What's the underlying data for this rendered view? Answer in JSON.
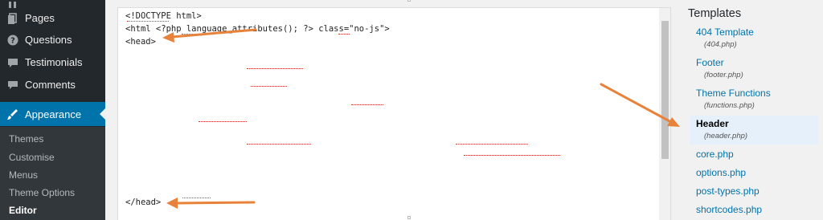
{
  "sidebar": {
    "items": [
      {
        "label": "Pages",
        "icon": "pages-icon"
      },
      {
        "label": "Questions",
        "icon": "question-icon"
      },
      {
        "label": "Testimonials",
        "icon": "testimonials-icon"
      },
      {
        "label": "Comments",
        "icon": "comments-icon"
      },
      {
        "label": "Appearance",
        "icon": "brush-icon"
      }
    ],
    "submenu": [
      "Themes",
      "Customise",
      "Menus",
      "Theme Options",
      "Editor"
    ]
  },
  "editor": {
    "lines": [
      "<!DOCTYPE html>",
      "<html <?php language_attributes(); ?> class=\"no-js\">",
      "<head>",
      "</head>"
    ]
  },
  "panel": {
    "title": "Templates",
    "templates": [
      {
        "name": "404 Template",
        "file": "(404.php)"
      },
      {
        "name": "Footer",
        "file": "(footer.php)"
      },
      {
        "name": "Theme Functions",
        "file": "(functions.php)"
      },
      {
        "name": "Header",
        "file": "(header.php)"
      },
      {
        "name": "core.php"
      },
      {
        "name": "options.php"
      },
      {
        "name": "post-types.php"
      },
      {
        "name": "shortcodes.php"
      }
    ]
  },
  "colors": {
    "sidebar_bg": "#23282d",
    "accent": "#0073aa",
    "annotation_arrow": "#e8823b"
  }
}
